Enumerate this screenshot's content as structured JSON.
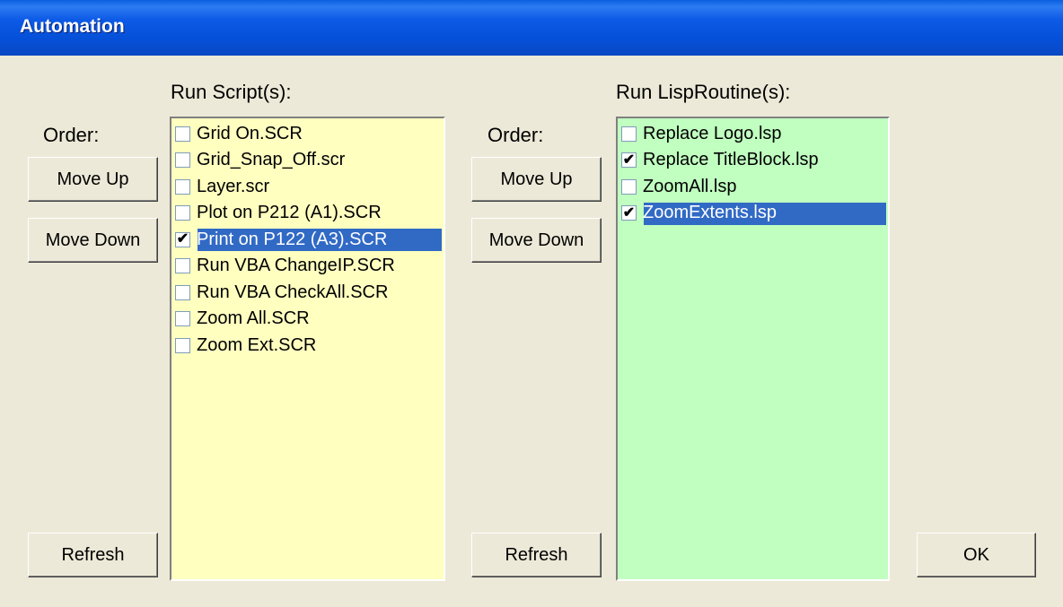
{
  "window": {
    "title": "Automation"
  },
  "scripts": {
    "header": "Run Script(s):",
    "order_label": "Order:",
    "move_up": "Move Up",
    "move_down": "Move Down",
    "refresh": "Refresh",
    "items": [
      {
        "label": "Grid On.SCR",
        "checked": false,
        "selected": false
      },
      {
        "label": "Grid_Snap_Off.scr",
        "checked": false,
        "selected": false
      },
      {
        "label": "Layer.scr",
        "checked": false,
        "selected": false
      },
      {
        "label": "Plot on P212 (A1).SCR",
        "checked": false,
        "selected": false
      },
      {
        "label": "Print on P122 (A3).SCR",
        "checked": true,
        "selected": true
      },
      {
        "label": "Run VBA ChangeIP.SCR",
        "checked": false,
        "selected": false
      },
      {
        "label": "Run VBA CheckAll.SCR",
        "checked": false,
        "selected": false
      },
      {
        "label": "Zoom All.SCR",
        "checked": false,
        "selected": false
      },
      {
        "label": "Zoom Ext.SCR",
        "checked": false,
        "selected": false
      }
    ]
  },
  "lisp": {
    "header": "Run LispRoutine(s):",
    "order_label": "Order:",
    "move_up": "Move Up",
    "move_down": "Move Down",
    "refresh": "Refresh",
    "items": [
      {
        "label": "Replace Logo.lsp",
        "checked": false,
        "selected": false
      },
      {
        "label": "Replace TitleBlock.lsp",
        "checked": true,
        "selected": false
      },
      {
        "label": "ZoomAll.lsp",
        "checked": false,
        "selected": false
      },
      {
        "label": "ZoomExtents.lsp",
        "checked": true,
        "selected": true
      }
    ]
  },
  "ok_label": "OK",
  "colors": {
    "title_bar": "#0a5fe0",
    "selection": "#316ac5",
    "script_list_bg": "#ffffc0",
    "lisp_list_bg": "#c0ffc0"
  },
  "icons": {
    "checkmark": "✔"
  }
}
